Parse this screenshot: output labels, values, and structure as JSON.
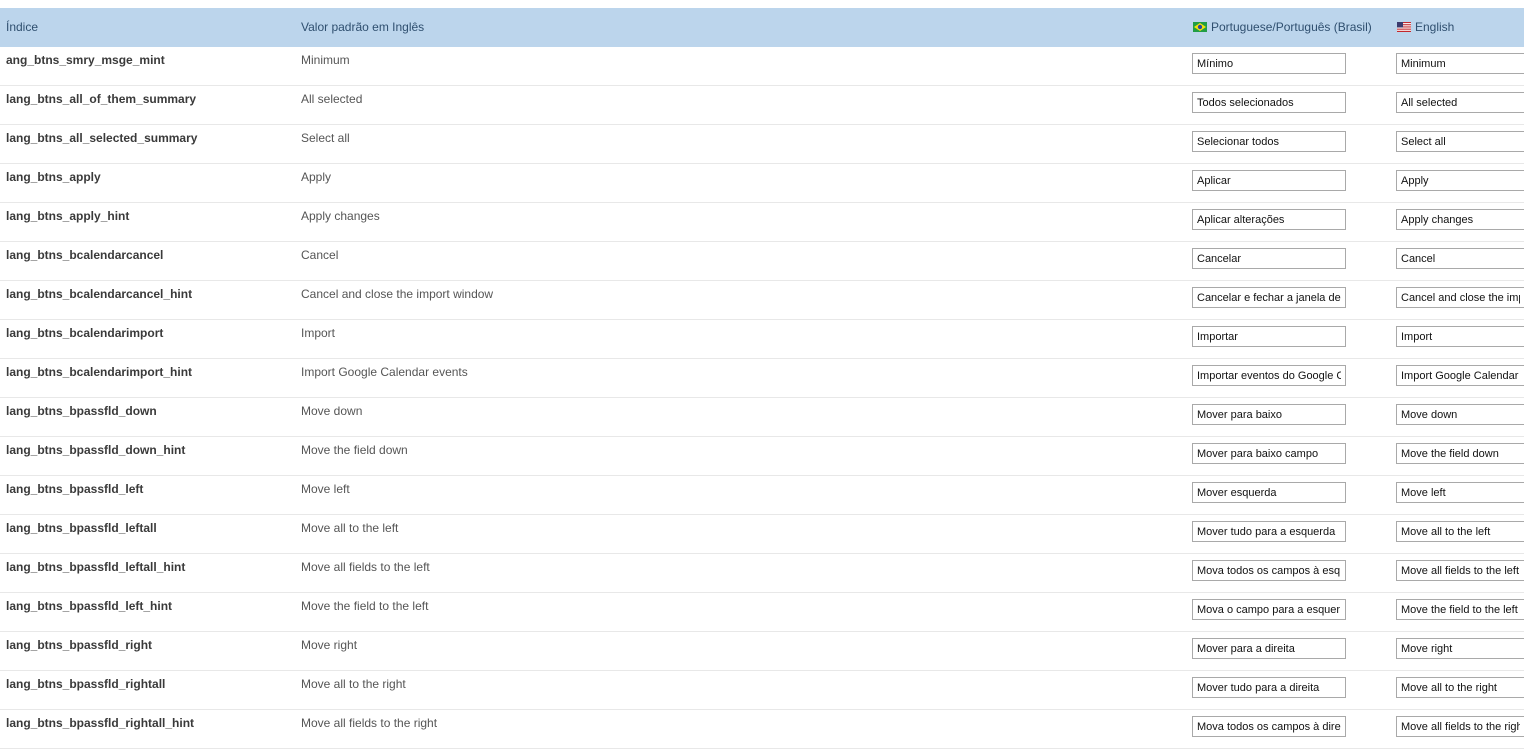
{
  "header": {
    "index": "Índice",
    "default_value": "Valor padrão em Inglês",
    "lang_pt": "Portuguese/Português (Brasil)",
    "lang_en": "English"
  },
  "rows": [
    {
      "key": "ang_btns_smry_msge_mint",
      "default": "Minimum",
      "pt": "Mínimo",
      "en": "Minimum"
    },
    {
      "key": "lang_btns_all_of_them_summary",
      "default": "All selected",
      "pt": "Todos selecionados",
      "en": "All selected"
    },
    {
      "key": "lang_btns_all_selected_summary",
      "default": "Select all",
      "pt": "Selecionar todos",
      "en": "Select all"
    },
    {
      "key": "lang_btns_apply",
      "default": "Apply",
      "pt": "Aplicar",
      "en": "Apply"
    },
    {
      "key": "lang_btns_apply_hint",
      "default": "Apply changes",
      "pt": "Aplicar alterações",
      "en": "Apply changes"
    },
    {
      "key": "lang_btns_bcalendarcancel",
      "default": "Cancel",
      "pt": "Cancelar",
      "en": "Cancel"
    },
    {
      "key": "lang_btns_bcalendarcancel_hint",
      "default": "Cancel and close the import window",
      "pt": "Cancelar e fechar a janela de",
      "en": "Cancel and close the imp"
    },
    {
      "key": "lang_btns_bcalendarimport",
      "default": "Import",
      "pt": "Importar",
      "en": "Import"
    },
    {
      "key": "lang_btns_bcalendarimport_hint",
      "default": "Import Google Calendar events",
      "pt": "Importar eventos do Google C",
      "en": "Import Google Calendar e"
    },
    {
      "key": "lang_btns_bpassfld_down",
      "default": "Move down",
      "pt": "Mover para baixo",
      "en": "Move down"
    },
    {
      "key": "lang_btns_bpassfld_down_hint",
      "default": "Move the field down",
      "pt": "Mover para baixo campo",
      "en": "Move the field down"
    },
    {
      "key": "lang_btns_bpassfld_left",
      "default": "Move left",
      "pt": "Mover esquerda",
      "en": "Move left"
    },
    {
      "key": "lang_btns_bpassfld_leftall",
      "default": "Move all to the left",
      "pt": "Mover tudo para a esquerda",
      "en": "Move all to the left"
    },
    {
      "key": "lang_btns_bpassfld_leftall_hint",
      "default": "Move all fields to the left",
      "pt": "Mova todos os campos à esq",
      "en": "Move all fields to the left"
    },
    {
      "key": "lang_btns_bpassfld_left_hint",
      "default": "Move the field to the left",
      "pt": "Mova o campo para a esquer",
      "en": "Move the field to the left"
    },
    {
      "key": "lang_btns_bpassfld_right",
      "default": "Move right",
      "pt": "Mover para a direita",
      "en": "Move right"
    },
    {
      "key": "lang_btns_bpassfld_rightall",
      "default": "Move all to the right",
      "pt": "Mover tudo para a direita",
      "en": "Move all to the right"
    },
    {
      "key": "lang_btns_bpassfld_rightall_hint",
      "default": "Move all fields to the right",
      "pt": "Mova todos os campos à dire",
      "en": "Move all fields to the right"
    }
  ],
  "icons": {
    "pt_flag": "brazil-flag-icon",
    "en_flag": "us-flag-icon"
  },
  "colors": {
    "header_bg": "#bcd5ec",
    "row_divider": "#e8e8e8"
  }
}
